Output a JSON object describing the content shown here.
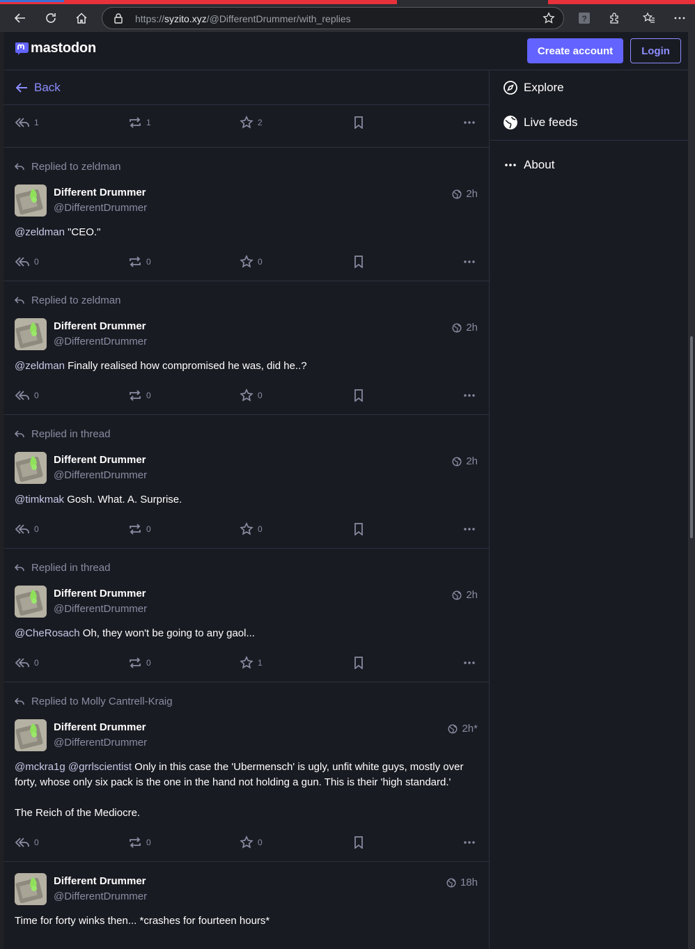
{
  "browser": {
    "url_prefix": "https://",
    "url_domain": "syzito.xyz",
    "url_path": "/@DifferentDrummer/with_replies"
  },
  "header": {
    "logo_text": "mastodon",
    "create_account_label": "Create account",
    "login_label": "Login"
  },
  "column": {
    "back_label": "Back",
    "first_actions": {
      "replies": "1",
      "boosts": "1",
      "favourites": "2"
    }
  },
  "statuses": [
    {
      "prepend": "Replied to zeldman",
      "display_name": "Different Drummer",
      "account": "@DifferentDrummer",
      "time": "2h",
      "mentions": "@zeldman",
      "text": " \"CEO.\"",
      "replies": "0",
      "boosts": "0",
      "favourites": "0"
    },
    {
      "prepend": "Replied to zeldman",
      "display_name": "Different Drummer",
      "account": "@DifferentDrummer",
      "time": "2h",
      "mentions": "@zeldman",
      "text": " Finally realised how compromised he was, did he..?",
      "replies": "0",
      "boosts": "0",
      "favourites": "0"
    },
    {
      "prepend": "Replied in thread",
      "display_name": "Different Drummer",
      "account": "@DifferentDrummer",
      "time": "2h",
      "mentions": "@timkmak",
      "text": " Gosh. What. A. Surprise.",
      "replies": "0",
      "boosts": "0",
      "favourites": "0"
    },
    {
      "prepend": "Replied in thread",
      "display_name": "Different Drummer",
      "account": "@DifferentDrummer",
      "time": "2h",
      "mentions": "@CheRosach",
      "text": " Oh, they won't be going to any gaol...",
      "replies": "0",
      "boosts": "0",
      "favourites": "1"
    },
    {
      "prepend": "Replied to Molly Cantrell-Kraig",
      "display_name": "Different Drummer",
      "account": "@DifferentDrummer",
      "time": "2h",
      "edited_mark": "*",
      "mentions": "@mckra1g @grrlscientist",
      "text": " Only in this case the 'Ubermensch' is ugly, unfit white guys, mostly over forty, whose only six pack is the one in the hand not holding a gun.   This is their 'high standard.'",
      "text2": "The Reich of the Mediocre.",
      "replies": "0",
      "boosts": "0",
      "favourites": "0"
    },
    {
      "display_name": "Different Drummer",
      "account": "@DifferentDrummer",
      "time": "18h",
      "text": "Time for forty winks then... *crashes for fourteen hours*"
    }
  ],
  "sidebar": {
    "explore": "Explore",
    "live_feeds": "Live feeds",
    "about": "About"
  },
  "colors": {
    "accent": "#6364ff",
    "accent_light": "#8c8dff",
    "background": "#191b22",
    "muted": "#8a8ca3"
  }
}
